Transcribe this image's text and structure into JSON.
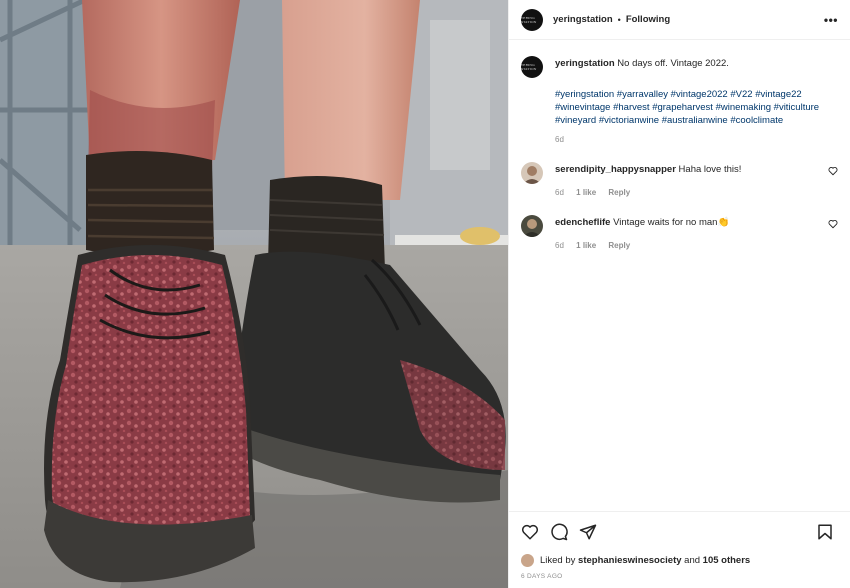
{
  "post": {
    "username": "yeringstation",
    "avatar_text": "YERING STATION",
    "follow_status": "Following",
    "more_icon": "more-options-icon"
  },
  "caption": {
    "username": "yeringstation",
    "text": "No days off. Vintage 2022.",
    "hashtags": [
      "#yeringstation",
      "#yarravalley",
      "#vintage2022",
      "#V22",
      "#vintage22",
      "#winevintage",
      "#harvest",
      "#grapeharvest",
      "#winemaking",
      "#viticulture",
      "#vineyard",
      "#victorianwine",
      "#australianwine",
      "#coolclimate"
    ],
    "time": "6d"
  },
  "comments": [
    {
      "username": "serendipity_happysnapper",
      "text": "Haha love this!",
      "time": "6d",
      "likes": "1 like",
      "reply": "Reply"
    },
    {
      "username": "edencheflife",
      "text": "Vintage waits for no man👏",
      "time": "6d",
      "likes": "1 like",
      "reply": "Reply"
    }
  ],
  "likes": {
    "prefix": "Liked by",
    "user": "stephanieswinesociety",
    "and": "and",
    "others": "105 others"
  },
  "date": "6 DAYS AGO",
  "colors": {
    "link": "#00376b",
    "muted": "#8e8e8e",
    "text": "#262626",
    "divider": "#efefef"
  }
}
